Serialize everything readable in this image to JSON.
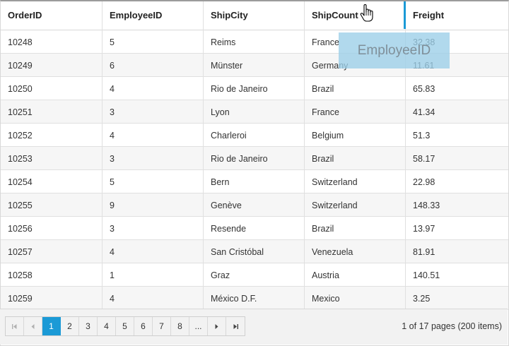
{
  "columns": [
    "OrderID",
    "EmployeeID",
    "ShipCity",
    "ShipCount",
    "Freight"
  ],
  "rows": [
    [
      "10248",
      "5",
      "Reims",
      "France",
      "32.38"
    ],
    [
      "10249",
      "6",
      "Münster",
      "Germany",
      "11.61"
    ],
    [
      "10250",
      "4",
      "Rio de Janeiro",
      "Brazil",
      "65.83"
    ],
    [
      "10251",
      "3",
      "Lyon",
      "France",
      "41.34"
    ],
    [
      "10252",
      "4",
      "Charleroi",
      "Belgium",
      "51.3"
    ],
    [
      "10253",
      "3",
      "Rio de Janeiro",
      "Brazil",
      "58.17"
    ],
    [
      "10254",
      "5",
      "Bern",
      "Switzerland",
      "22.98"
    ],
    [
      "10255",
      "9",
      "Genève",
      "Switzerland",
      "148.33"
    ],
    [
      "10256",
      "3",
      "Resende",
      "Brazil",
      "13.97"
    ],
    [
      "10257",
      "4",
      "San Cristóbal",
      "Venezuela",
      "81.91"
    ],
    [
      "10258",
      "1",
      "Graz",
      "Austria",
      "140.51"
    ],
    [
      "10259",
      "4",
      "México D.F.",
      "Mexico",
      "3.25"
    ]
  ],
  "drag_clone": {
    "label": "EmployeeID"
  },
  "pager": {
    "first_icon": "first-page-icon",
    "prev_icon": "prev-page-icon",
    "pages": [
      "1",
      "2",
      "3",
      "4",
      "5",
      "6",
      "7",
      "8"
    ],
    "active_page": "1",
    "ellipsis": "...",
    "next_icon": "next-page-icon",
    "last_icon": "last-page-icon",
    "info": "1 of 17 pages (200 items)"
  },
  "cursor_icon": "hand-pointer-icon",
  "colors": {
    "accent": "#1b9ad6",
    "alt_row": "#f6f6f6",
    "drag_clone_bg": "#9bcee8"
  }
}
